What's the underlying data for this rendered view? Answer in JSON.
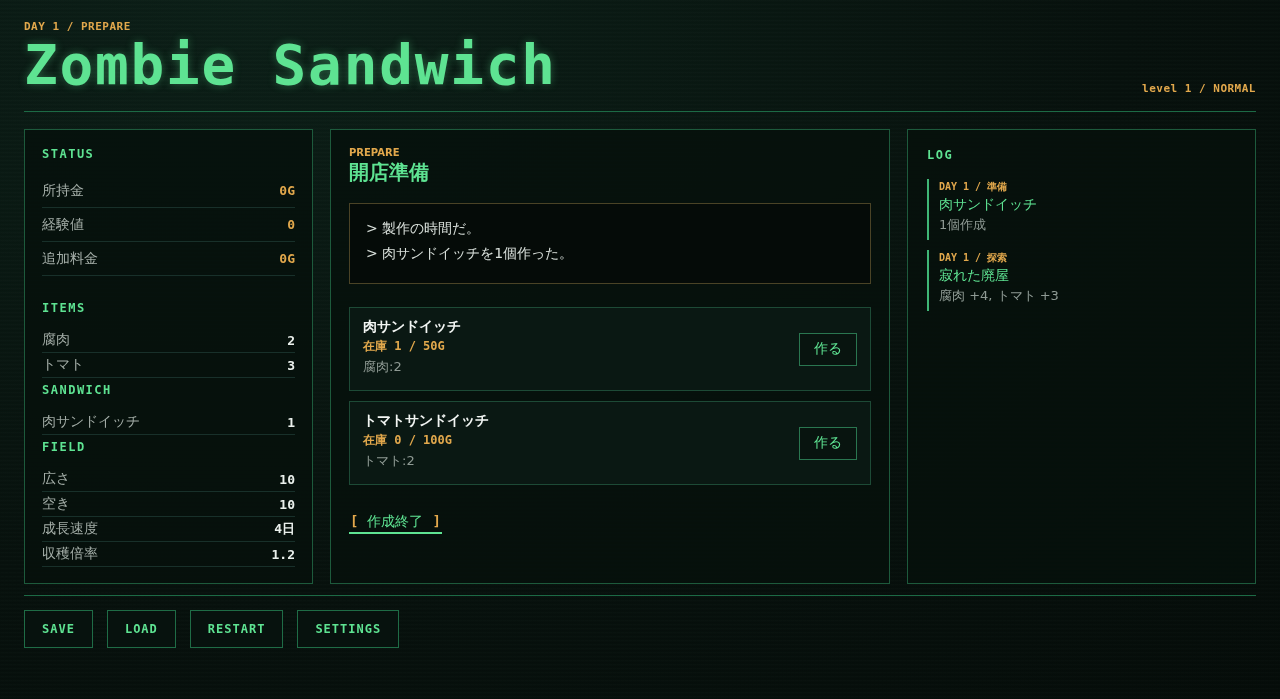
{
  "header": {
    "subtitle": "DAY 1 / PREPARE",
    "title": "Zombie Sandwich",
    "level": "level 1 / NORMAL"
  },
  "sidebar": {
    "sections": [
      {
        "heading": "STATUS",
        "kind": "status",
        "rows": [
          {
            "label": "所持金",
            "value": "0G"
          },
          {
            "label": "経験値",
            "value": "0"
          },
          {
            "label": "追加料金",
            "value": "0G"
          }
        ]
      },
      {
        "heading": "ITEMS",
        "kind": "compact",
        "rows": [
          {
            "label": "腐肉",
            "value": "2"
          },
          {
            "label": "トマト",
            "value": "3"
          }
        ]
      },
      {
        "heading": "SANDWICH",
        "kind": "compact",
        "rows": [
          {
            "label": "肉サンドイッチ",
            "value": "1"
          }
        ]
      },
      {
        "heading": "FIELD",
        "kind": "compact",
        "rows": [
          {
            "label": "広さ",
            "value": "10"
          },
          {
            "label": "空き",
            "value": "10"
          },
          {
            "label": "成長速度",
            "value": "4日"
          },
          {
            "label": "収穫倍率",
            "value": "1.2"
          }
        ]
      }
    ]
  },
  "main": {
    "eyebrow": "PREPARE",
    "title": "開店準備",
    "messages": [
      "> 製作の時間だ。",
      "> 肉サンドイッチを1個作った。"
    ],
    "recipes": [
      {
        "name": "肉サンドイッチ",
        "stock": "在庫 1 / 50G",
        "ingredients": "腐肉:2",
        "button": "作る"
      },
      {
        "name": "トマトサンドイッチ",
        "stock": "在庫 0 / 100G",
        "ingredients": "トマト:2",
        "button": "作る"
      }
    ],
    "finish_button": {
      "open": "[",
      "label": "作成終了",
      "close": "]"
    }
  },
  "log": {
    "heading": "LOG",
    "entries": [
      {
        "meta": "DAY 1 / 準備",
        "title": "肉サンドイッチ",
        "detail": "1個作成"
      },
      {
        "meta": "DAY 1 / 探索",
        "title": "寂れた廃屋",
        "detail": "腐肉 +4, トマト +3"
      }
    ]
  },
  "footer": {
    "buttons": [
      "SAVE",
      "LOAD",
      "RESTART",
      "SETTINGS"
    ]
  }
}
